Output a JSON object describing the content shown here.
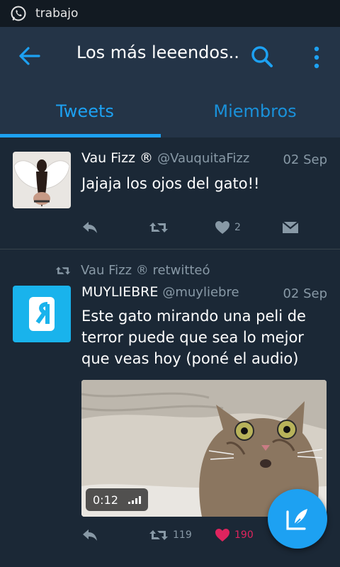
{
  "status_bar": {
    "app_name": "trabajo"
  },
  "toolbar": {
    "title": "Los más leeendos..",
    "back_icon": "arrow-left-icon",
    "search_icon": "search-icon",
    "more_icon": "more-vertical-icon"
  },
  "tabs": [
    {
      "label": "Tweets",
      "active": true
    },
    {
      "label": "Miembros",
      "active": false
    }
  ],
  "tweets": [
    {
      "display_name": "Vau Fizz ®",
      "handle": "@VauquitaFizz",
      "date": "02 Sep",
      "text": "Jajaja los ojos del gato!!",
      "likes": "2",
      "retweets": "",
      "liked": false
    },
    {
      "retweeted_by": "Vau Fizz ® retwitteó",
      "display_name": "MUYLIEBRE",
      "handle": "@muyliebre",
      "date": "02 Sep",
      "text": "Este gato mirando una peli de terror puede que sea lo mejor que veas hoy (poné el audio)",
      "media_duration": "0:12",
      "retweets": "119",
      "likes": "190",
      "liked": true
    }
  ],
  "fab": {
    "icon": "compose-tweet-icon"
  },
  "colors": {
    "accent": "#1da1f2",
    "background": "#1b2836",
    "toolbar": "#243447",
    "like": "#e0245e",
    "muted": "#8899a6"
  }
}
